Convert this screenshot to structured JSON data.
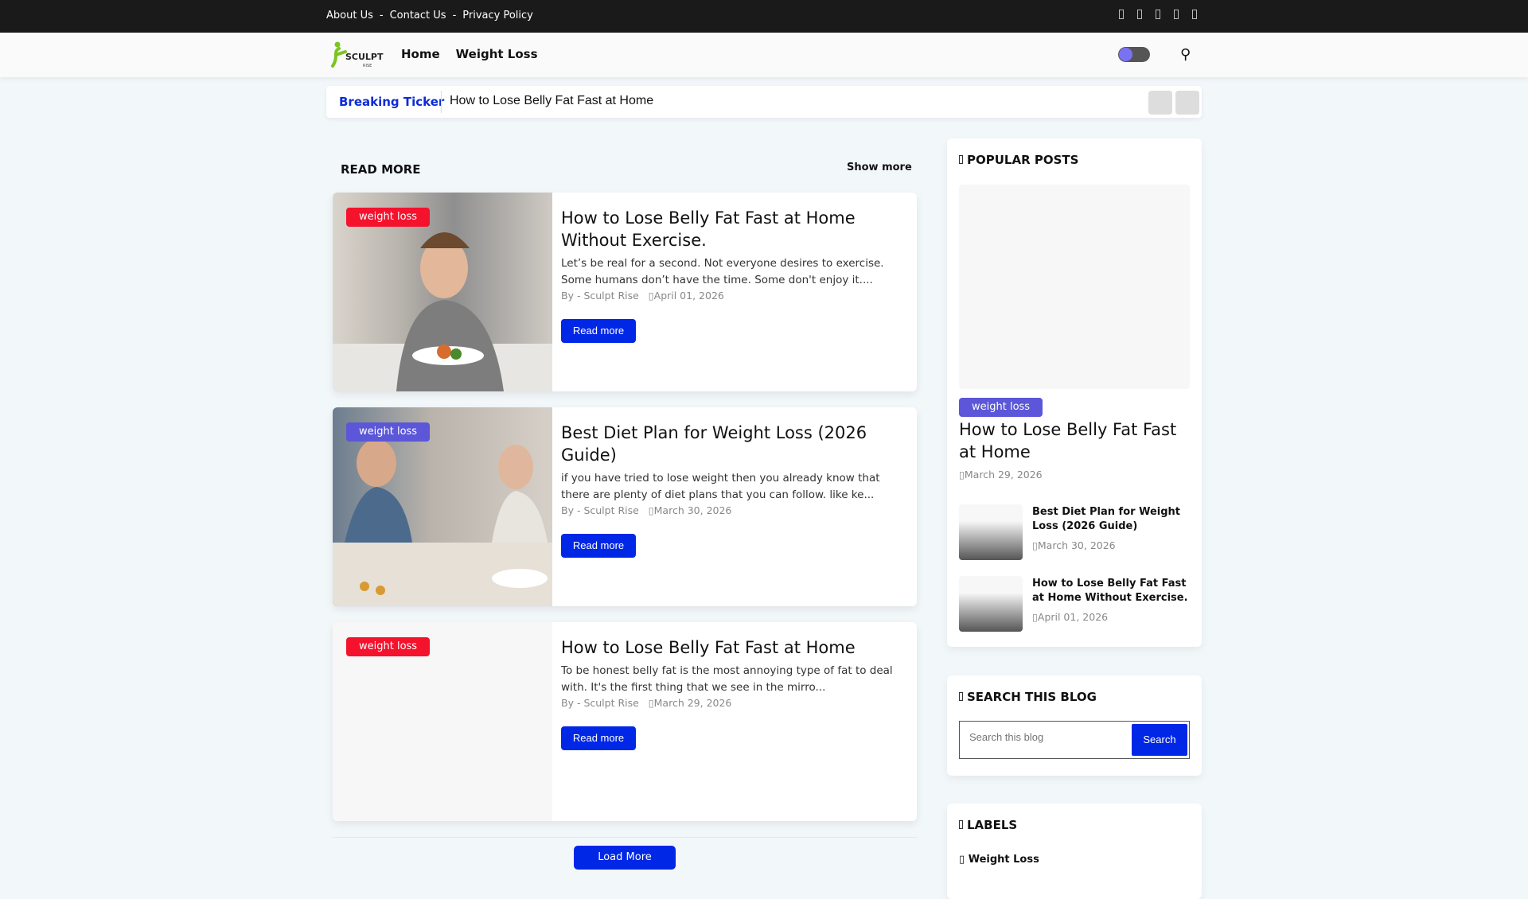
{
  "topbar": {
    "links": [
      "About Us",
      "Contact Us",
      "Privacy Policy"
    ],
    "separator": "-",
    "social_icons": [
      "facebook-icon",
      "twitter-icon",
      "instagram-icon",
      "pinterest-icon",
      "youtube-icon"
    ]
  },
  "nav": {
    "logo_text": "SCULPT RISE",
    "links": [
      "Home",
      "Weight Loss"
    ]
  },
  "ticker": {
    "label": "Breaking Ticker",
    "text": "How to Lose Belly Fat Fast at Home"
  },
  "main": {
    "section_title": "READ MORE",
    "show_more": "Show more",
    "load_more": "Load More",
    "posts": [
      {
        "badge": "weight loss",
        "title": "How to Lose Belly Fat Fast at Home Without Exercise.",
        "excerpt": "Let’s be real for a second. Not everyone desires to exercise. Some humans don’t have the time. Some don't enjoy it....",
        "author_prefix": "By -",
        "author": "Sculpt Rise",
        "date": "April 01, 2026",
        "button": "Read more"
      },
      {
        "badge": "weight loss",
        "title": "Best Diet Plan for Weight Loss (2026 Guide)",
        "excerpt": "if you have tried to lose weight then you already know that there are plenty of diet plans that you can follow. like ke...",
        "author_prefix": "By -",
        "author": "Sculpt Rise",
        "date": "March 30, 2026",
        "button": "Read more"
      },
      {
        "badge": "weight loss",
        "title": "How to Lose Belly Fat Fast at Home",
        "excerpt": "To be honest belly fat is the most annoying type of fat to deal with. It's the first thing that we see in the mirro...",
        "author_prefix": "By -",
        "author": "Sculpt Rise",
        "date": "March 29, 2026",
        "button": "Read more"
      }
    ]
  },
  "sidebar": {
    "popular": {
      "title": "POPULAR POSTS",
      "featured": {
        "badge": "weight loss",
        "title": "How to Lose Belly Fat Fast at Home",
        "date": "March 29, 2026"
      },
      "items": [
        {
          "title": "Best Diet Plan for Weight Loss (2026 Guide)",
          "date": "March 30, 2026"
        },
        {
          "title": "How to Lose Belly Fat Fast at Home Without Exercise.",
          "date": "April 01, 2026"
        }
      ]
    },
    "search": {
      "title": "SEARCH THIS BLOG",
      "placeholder": "Search this blog",
      "button": "Search"
    },
    "labels": {
      "title": "LABELS",
      "items": [
        "Weight Loss"
      ]
    }
  },
  "colors": {
    "badge_red": "#f5122d",
    "badge_purple": "#5b57d8",
    "accent_blue": "#0027e6"
  }
}
